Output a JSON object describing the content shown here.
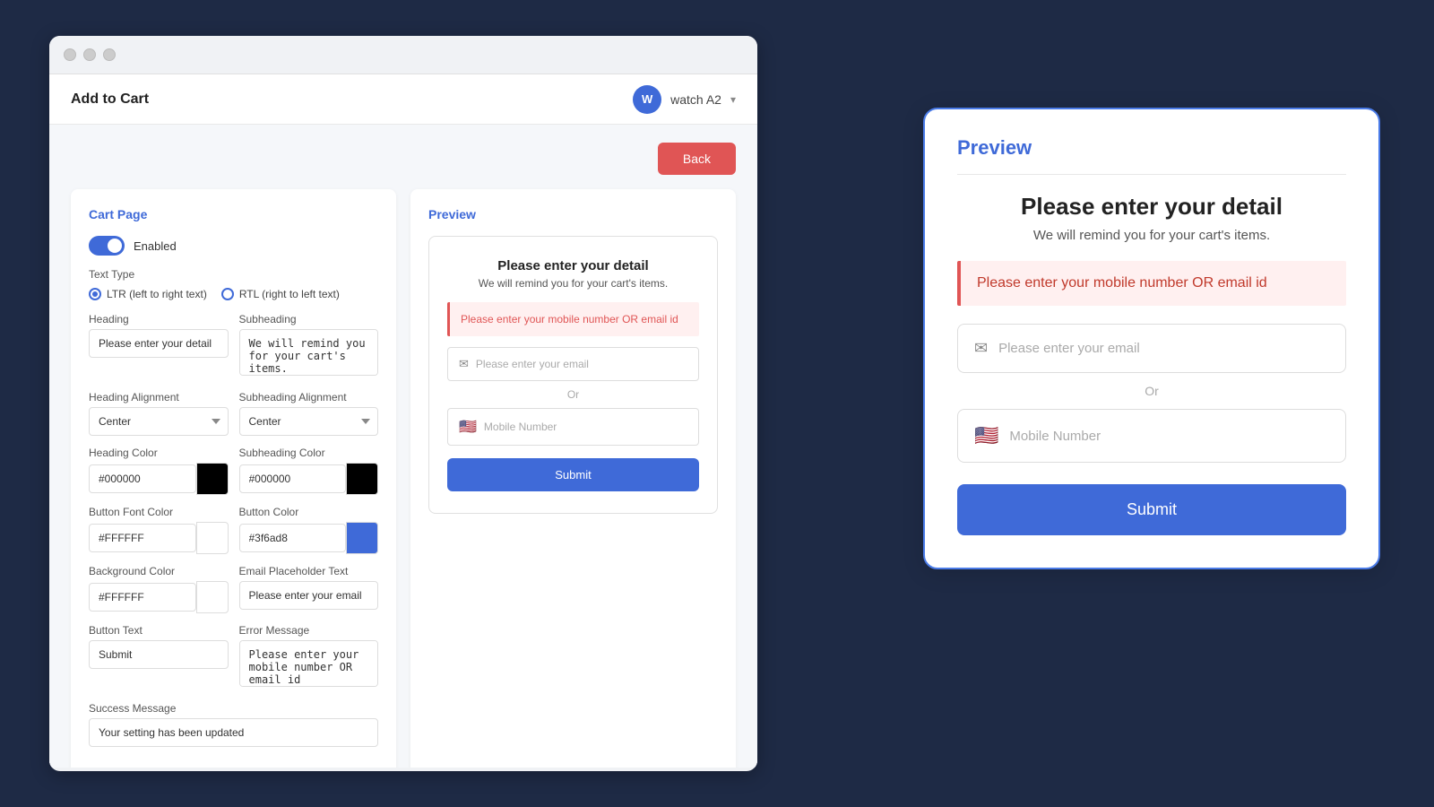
{
  "browser": {
    "dots": [
      "dot1",
      "dot2",
      "dot3"
    ]
  },
  "header": {
    "title": "Add to Cart",
    "avatar_letter": "W",
    "watch_label": "watch A2",
    "chevron": "▾"
  },
  "toolbar": {
    "back_label": "Back"
  },
  "cart_page": {
    "panel_title": "Cart Page",
    "enabled_label": "Enabled",
    "text_type_label": "Text Type",
    "ltr_label": "LTR (left to right text)",
    "rtl_label": "RTL (right to left text)",
    "heading_label": "Heading",
    "heading_value": "Please enter your detail",
    "subheading_label": "Subheading",
    "subheading_value": "We will remind you for your cart's items.",
    "heading_alignment_label": "Heading Alignment",
    "heading_alignment_value": "Center",
    "subheading_alignment_label": "Subheading Alignment",
    "subheading_alignment_value": "Center",
    "heading_color_label": "Heading Color",
    "heading_color_value": "#000000",
    "heading_color_swatch": "#000000",
    "subheading_color_label": "Subheading Color",
    "subheading_color_value": "#000000",
    "subheading_color_swatch": "#000000",
    "button_font_color_label": "Button Font Color",
    "button_font_color_value": "#FFFFFF",
    "button_color_label": "Button Color",
    "button_color_value": "#3f6ad8",
    "button_color_swatch": "#3f6ad8",
    "bg_color_label": "Background Color",
    "bg_color_value": "#FFFFFF",
    "email_placeholder_label": "Email Placeholder Text",
    "email_placeholder_value": "Please enter your email",
    "button_text_label": "Button Text",
    "button_text_value": "Submit",
    "error_message_label": "Error Message",
    "error_message_value": "Please enter your mobile number OR email id",
    "success_message_label": "Success Message",
    "success_message_value": "Your setting has been updated"
  },
  "preview_middle": {
    "panel_title": "Preview",
    "heading": "Please enter your detail",
    "subheading": "We will remind you for your cart's items.",
    "error_text": "Please enter your mobile number OR email id",
    "email_placeholder": "Please enter your email",
    "or_text": "Or",
    "phone_placeholder": "Mobile Number",
    "submit_label": "Submit"
  },
  "preview_large": {
    "title": "Preview",
    "heading": "Please enter your detail",
    "subheading": "We will remind you for your cart's items.",
    "error_text": "Please enter your mobile number OR email id",
    "email_placeholder": "Please enter your email",
    "or_text": "Or",
    "phone_placeholder": "Mobile Number",
    "submit_label": "Submit"
  }
}
